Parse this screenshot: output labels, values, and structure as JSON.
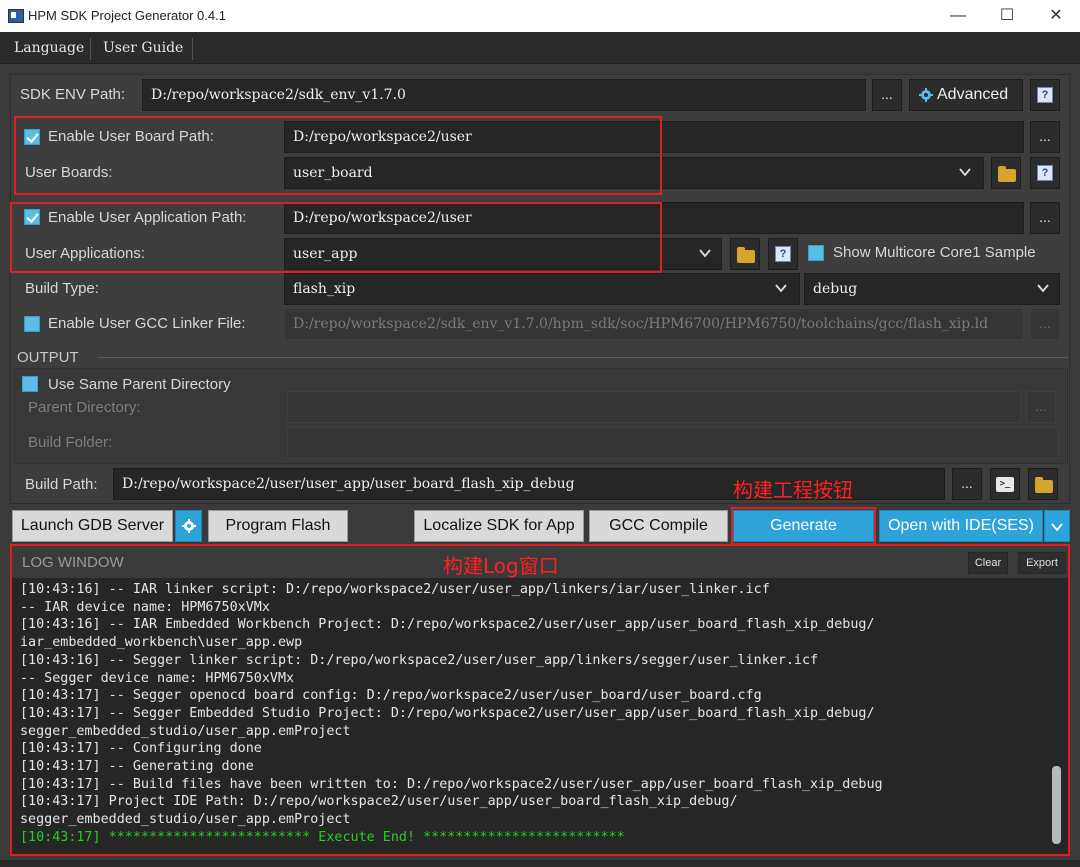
{
  "window": {
    "title": "HPM SDK Project Generator 0.4.1",
    "minimize": "—",
    "maximize": "☐",
    "close": "✕"
  },
  "menu": {
    "language": "Language",
    "user_guide": "User Guide"
  },
  "sdk": {
    "label": "SDK ENV Path:",
    "value": "D:/repo/workspace2/sdk_env_v1.7.0",
    "browse": "...",
    "advanced": "Advanced",
    "help": "?"
  },
  "board": {
    "enable_label": "Enable User Board Path:",
    "enable_checked": true,
    "path": "D:/repo/workspace2/user",
    "browse": "...",
    "boards_label": "User Boards:",
    "boards_value": "user_board",
    "help": "?"
  },
  "app": {
    "enable_label": "Enable User Application Path:",
    "enable_checked": true,
    "path": "D:/repo/workspace2/user",
    "browse": "...",
    "apps_label": "User Applications:",
    "apps_value": "user_app",
    "help": "?",
    "multicore_label": "Show Multicore Core1 Sample",
    "multicore_checked": false
  },
  "build": {
    "type_label": "Build Type:",
    "type_value": "flash_xip",
    "variant_value": "debug"
  },
  "linker": {
    "label": "Enable User GCC Linker File:",
    "checked": false,
    "value": "D:/repo/workspace2/sdk_env_v1.7.0/hpm_sdk/soc/HPM6700/HPM6750/toolchains/gcc/flash_xip.ld",
    "browse": "..."
  },
  "output": {
    "section_label": "OUTPUT",
    "same_parent_label": "Use Same Parent Directory",
    "same_parent_checked": false,
    "parent_dir_label": "Parent Directory:",
    "build_folder_label": "Build Folder:",
    "browse": "...",
    "build_path_label": "Build Path:",
    "build_path_value": "D:/repo/workspace2/user/user_app/user_board_flash_xip_debug",
    "terminal_icon": ">_"
  },
  "actions": {
    "launch_gdb": "Launch GDB Server",
    "program_flash": "Program Flash",
    "localize_sdk": "Localize SDK for App",
    "gcc_compile": "GCC Compile",
    "generate": "Generate",
    "open_ide": "Open with IDE(SES)"
  },
  "annotations": {
    "generate_note": "构建工程按钮",
    "log_note": "构建Log窗口"
  },
  "log": {
    "title": "LOG WINDOW",
    "clear": "Clear",
    "export": "Export",
    "lines": [
      "[10:43:16] -- IAR linker script: D:/repo/workspace2/user/user_app/linkers/iar/user_linker.icf",
      "-- IAR device name: HPM6750xVMx",
      "[10:43:16] -- IAR Embedded Workbench Project: D:/repo/workspace2/user/user_app/user_board_flash_xip_debug/",
      "iar_embedded_workbench\\user_app.ewp",
      "[10:43:16] -- Segger linker script: D:/repo/workspace2/user/user_app/linkers/segger/user_linker.icf",
      "-- Segger device name: HPM6750xVMx",
      "[10:43:17] -- Segger openocd board config: D:/repo/workspace2/user/user_board/user_board.cfg",
      "[10:43:17] -- Segger Embedded Studio Project: D:/repo/workspace2/user/user_app/user_board_flash_xip_debug/",
      "segger_embedded_studio/user_app.emProject",
      "[10:43:17] -- Configuring done",
      "[10:43:17] -- Generating done",
      "[10:43:17] -- Build files have been written to: D:/repo/workspace2/user/user_app/user_board_flash_xip_debug",
      "[10:43:17] Project IDE Path: D:/repo/workspace2/user/user_app/user_board_flash_xip_debug/",
      "segger_embedded_studio/user_app.emProject",
      "[10:43:17] ************************* Execute End! *************************"
    ]
  },
  "colors": {
    "accent": "#2ea3d9",
    "annotation": "#e02020",
    "log_success": "#22d022"
  }
}
